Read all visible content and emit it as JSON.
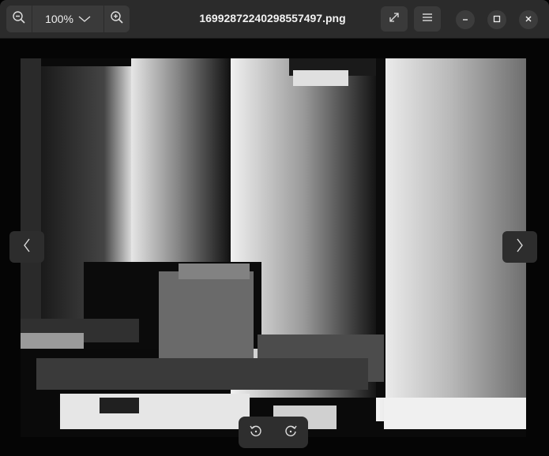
{
  "window": {
    "title": "16992872240298557497.png"
  },
  "toolbar": {
    "zoom_level": "100%",
    "zoom_out_icon": "zoom-out-icon",
    "zoom_in_icon": "zoom-in-icon",
    "zoom_menu_icon": "chevron-down-icon",
    "fullscreen_icon": "expand-icon",
    "menu_icon": "hamburger-menu-icon"
  },
  "window_controls": {
    "minimize_icon": "minimize-icon",
    "maximize_icon": "maximize-icon",
    "close_icon": "close-icon"
  },
  "navigation": {
    "previous_icon": "chevron-left-icon",
    "next_icon": "chevron-right-icon"
  },
  "rotate": {
    "rotate_left_icon": "rotate-left-icon",
    "rotate_right_icon": "rotate-right-icon"
  },
  "colors": {
    "headerbar": "#2b2b2b",
    "button": "#3a3a3a",
    "background": "#050505"
  }
}
